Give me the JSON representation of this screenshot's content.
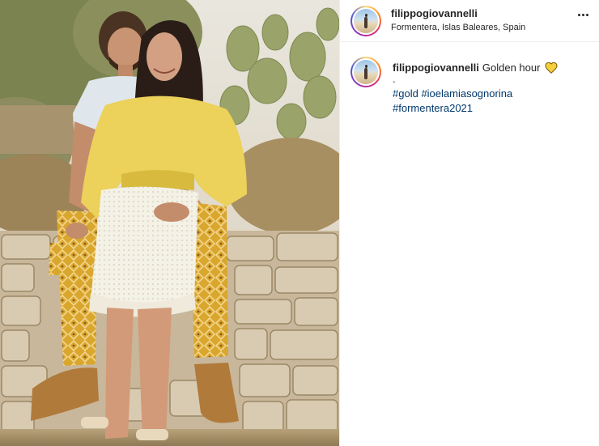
{
  "post": {
    "username": "filippogiovannelli",
    "location": "Formentera, Islas Baleares, Spain",
    "more_icon": "more-options-icon",
    "caption": {
      "username": "filippogiovannelli",
      "text": "Golden hour",
      "emoji": "yellow-heart-icon",
      "separator": ".",
      "hashtags": [
        "#gold",
        "#ioelamiasognorina",
        "#formentera2021"
      ]
    }
  },
  "colors": {
    "hashtag": "#00376b",
    "text": "#262626",
    "heart": "#f4d03f"
  }
}
